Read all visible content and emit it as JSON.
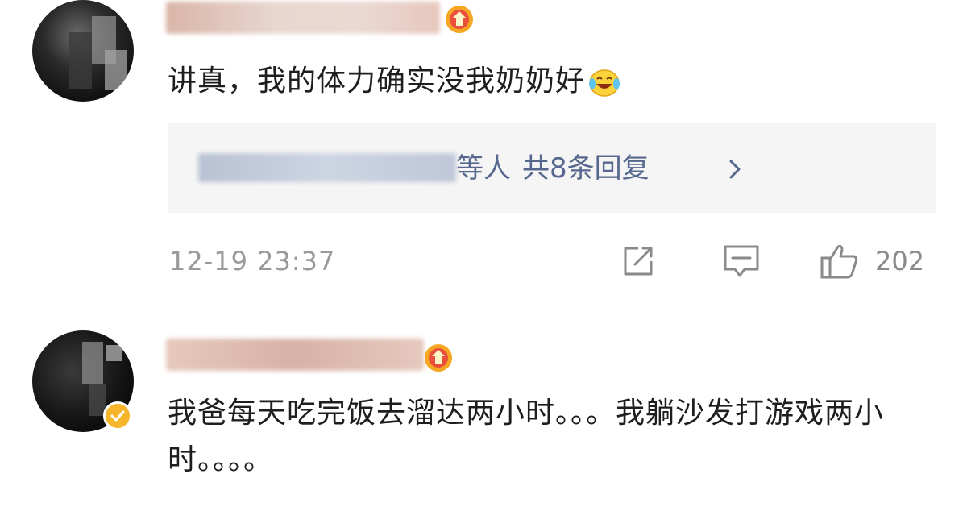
{
  "comments": [
    {
      "text": "讲真，我的体力确实没我奶奶好",
      "reply_preview": {
        "suffix": "等人",
        "count_text": "共8条回复"
      },
      "timestamp": "12-19 23:37",
      "likes": "202"
    },
    {
      "text": "我爸每天吃完饭去溜达两小时。。。我躺沙发打游戏两小时。。。。"
    }
  ],
  "icons": {
    "share": "share-icon",
    "reply": "comment-icon",
    "like": "thumbs-up-icon",
    "badge": "vip-badge-icon",
    "emoji": "laughing-crying-emoji-icon",
    "verified": "verified-icon",
    "chevron": "chevron-right-icon"
  },
  "colors": {
    "link_blue": "#57688f",
    "meta_gray": "#9a9a9a",
    "verified_orange": "#f6b52a",
    "reply_bg": "#f5f5f5"
  }
}
